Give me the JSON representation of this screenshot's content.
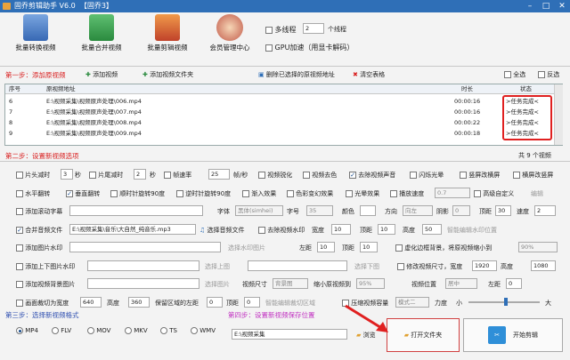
{
  "app": {
    "title": "固乔剪辑助手 V6.0",
    "edition": "【固乔3】"
  },
  "toolbar": {
    "items": [
      {
        "label": "批量转换视频"
      },
      {
        "label": "批量合并视频"
      },
      {
        "label": "批量剪辑视频"
      },
      {
        "label": "会员管理中心"
      }
    ],
    "multithread_label": "多线程",
    "thread_count": "2",
    "thread_unit": "个线程",
    "gpu_label": "GPU加速（用显卡解码）"
  },
  "step1": {
    "label": "第一步：添加原视频",
    "add_video": "添加视频",
    "add_folder": "添加视频文件夹",
    "remove_selected": "删除已选择的原视频地址",
    "clear_table": "清空表格",
    "select_all": "全选",
    "invert": "反选"
  },
  "table": {
    "headers": {
      "index": "序号",
      "path": "原视频地址",
      "duration": "时长",
      "status": "状态"
    },
    "rows": [
      {
        "index": "6",
        "path": "E:\\视频采集\\视频原声处理\\006.mp4",
        "duration": "00:00:16",
        "status": ">任务完成<"
      },
      {
        "index": "7",
        "path": "E:\\视频采集\\视频原声处理\\007.mp4",
        "duration": "00:00:16",
        "status": ">任务完成<"
      },
      {
        "index": "8",
        "path": "E:\\视频采集\\视频原声处理\\008.mp4",
        "duration": "00:00:22",
        "status": ">任务完成<"
      },
      {
        "index": "9",
        "path": "E:\\视频采集\\视频原声处理\\009.mp4",
        "duration": "00:00:18",
        "status": ">任务完成<"
      }
    ]
  },
  "step2": {
    "label": "第二步：设置新视频选项",
    "count": "共 9 个视频"
  },
  "opts": {
    "head_cut": "片头减时",
    "head_val": "3",
    "sec": "秒",
    "tail_cut": "片尾减时",
    "tail_val": "2",
    "sec2": "秒",
    "fps": "帧速率",
    "fps_val": "25",
    "fps_unit": "帧/秒",
    "sharpen": "视频锐化",
    "decolor": "视频去色",
    "remove_audio": "去除视频声音",
    "flash": "闪烁光晕",
    "vertical_blur": "竖屏改横屏",
    "horizontal_blur": "横屏改竖屏",
    "hflip": "水平翻转",
    "vflip": "垂直翻转",
    "rot90cw": "顺时针旋转90度",
    "rot90ccw": "逆时针旋转90度",
    "fade": "渐入效果",
    "color_change": "色彩变幻效果",
    "light": "光晕效果",
    "speed": "播放速度",
    "speed_val": "0.7",
    "advanced": "高级自定义",
    "edit": "编辑",
    "scroll_sub": "添加滚动字幕",
    "font": "字体",
    "font_val": "黑体(simhei)",
    "size": "字号",
    "size_val": "35",
    "color": "颜色",
    "direction": "方向",
    "direction_val": "向左",
    "shadow": "阴影",
    "shadow_val": "0",
    "top": "顶距",
    "top_val": "30",
    "speed2": "速度",
    "speed2_val": "2",
    "merge_audio": "合并音频文件",
    "audio_path": "E:\\视频采集\\音乐\\大自然_纯音乐.mp3",
    "choose_audio": "选择音频文件",
    "remove_wm": "去除视频水印",
    "wm_width": "宽度",
    "wm_width_val": "10",
    "wm_top": "顶距",
    "wm_top_val": "10",
    "wm_height": "高度",
    "wm_height_val": "50",
    "smart_wm": "智能编辑水印位置",
    "image_wm": "添加图片水印",
    "choose_wm": "选择水印图片",
    "img_left": "左距",
    "img_left_val": "10",
    "img_top": "顶距",
    "img_top_val": "10",
    "blur_bg": "虚化边框背景，将原视频缩小到",
    "blur_val": "90%",
    "topbottom_wm": "添加上下图片水印",
    "choose_top": "选择上图",
    "choose_bottom": "选择下图",
    "modify_res": "修改视频尺寸，宽度",
    "res_w": "1920",
    "res_x": "高度",
    "res_h": "1080",
    "bg_image": "添加视频背景图片",
    "choose_bg": "选择图片",
    "video_size": "视频尺寸",
    "video_size_val": "背景图",
    "shrink": "缩小原视频到",
    "shrink_val": "95%",
    "position": "视频位置",
    "position_val": "居中",
    "left2": "左距",
    "left2_val": "0",
    "crop": "画面裁切为宽度",
    "crop_w": "640",
    "crop_h_label": "高度",
    "crop_h": "360",
    "keep_left": "保留区域的左距",
    "keep_left_val": "0",
    "keep_top": "顶距",
    "keep_top_val": "0",
    "smart_crop": "智能编辑裁切区域",
    "compress": "压缩视频容量",
    "mode": "模式二",
    "strength": "力度",
    "small": "小",
    "large": "大"
  },
  "step3": {
    "label": "第三步：选择新视频格式",
    "formats": [
      "MP4",
      "FLV",
      "MOV",
      "MKV",
      "TS",
      "WMV"
    ],
    "selected": "MP4"
  },
  "step4": {
    "label": "第四步：设置新视频保存位置",
    "path": "E:\\视频采集",
    "browse": "浏览",
    "open_folder": "打开文件夹",
    "start": "开始剪辑"
  }
}
